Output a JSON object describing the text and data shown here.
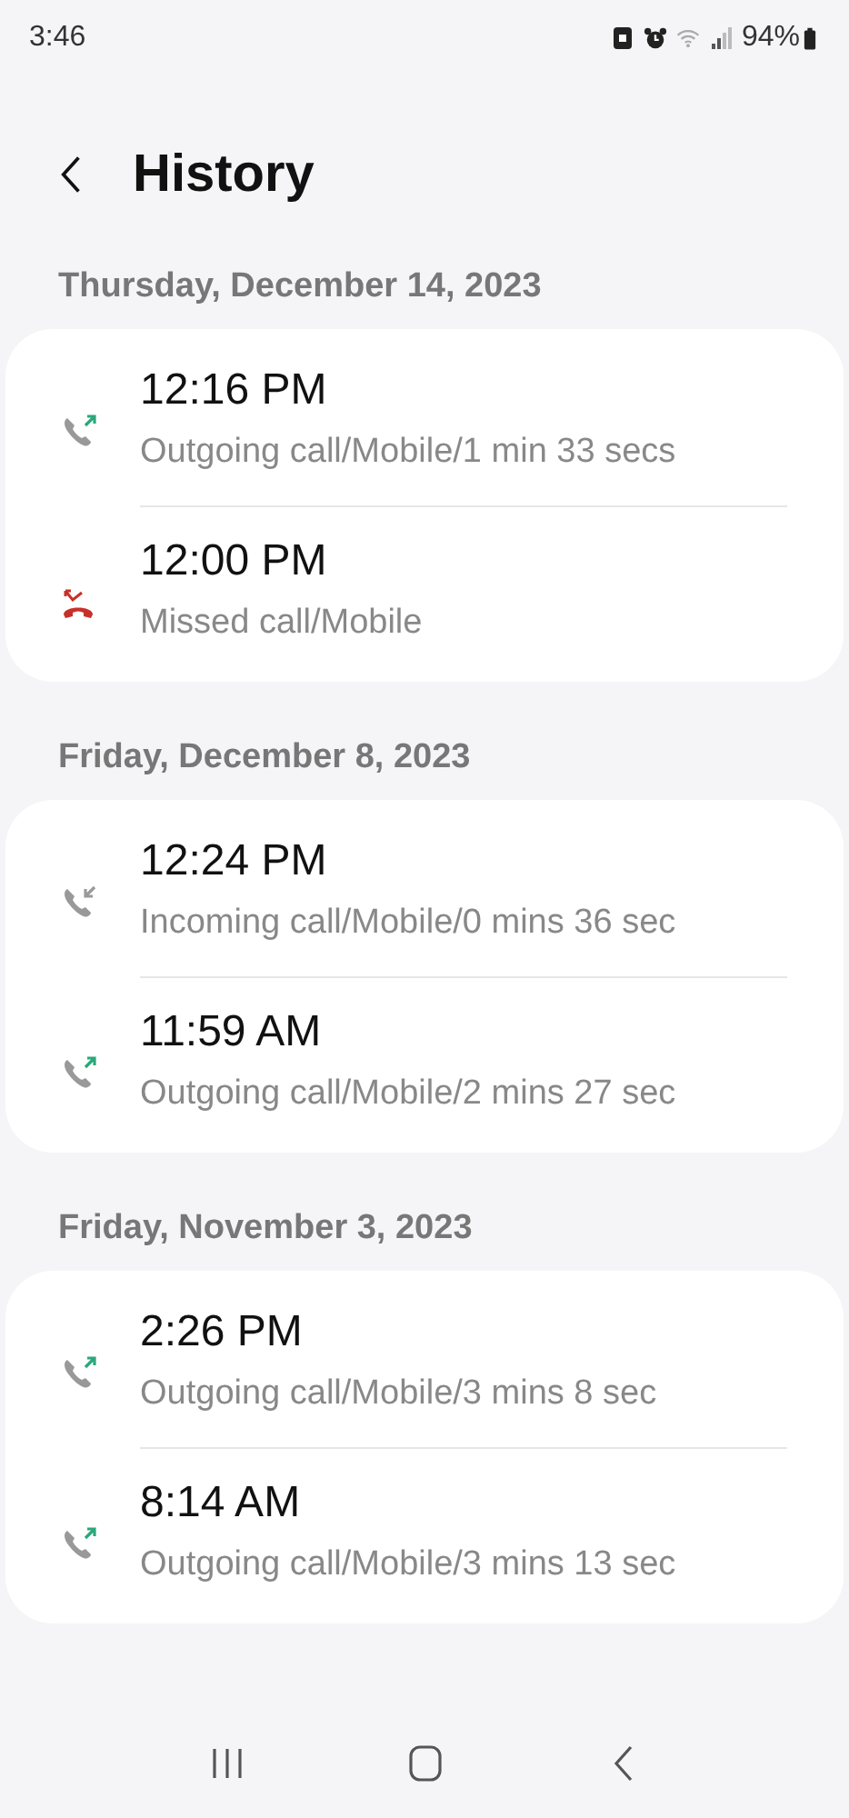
{
  "status_bar": {
    "time": "3:46",
    "battery": "94%"
  },
  "header": {
    "title": "History"
  },
  "sections": [
    {
      "date": "Thursday, December 14, 2023",
      "calls": [
        {
          "kind": "outgoing",
          "time": "12:16 PM",
          "detail": "Outgoing call/Mobile/1 min 33 secs"
        },
        {
          "kind": "missed",
          "time": "12:00 PM",
          "detail": "Missed call/Mobile"
        }
      ]
    },
    {
      "date": "Friday, December 8, 2023",
      "calls": [
        {
          "kind": "incoming",
          "time": "12:24 PM",
          "detail": "Incoming call/Mobile/0 mins 36 sec"
        },
        {
          "kind": "outgoing",
          "time": "11:59 AM",
          "detail": "Outgoing call/Mobile/2 mins 27 sec"
        }
      ]
    },
    {
      "date": "Friday, November 3, 2023",
      "calls": [
        {
          "kind": "outgoing",
          "time": "2:26 PM",
          "detail": "Outgoing call/Mobile/3 mins 8 sec"
        },
        {
          "kind": "outgoing",
          "time": "8:14 AM",
          "detail": "Outgoing call/Mobile/3 mins 13 sec"
        }
      ]
    }
  ]
}
